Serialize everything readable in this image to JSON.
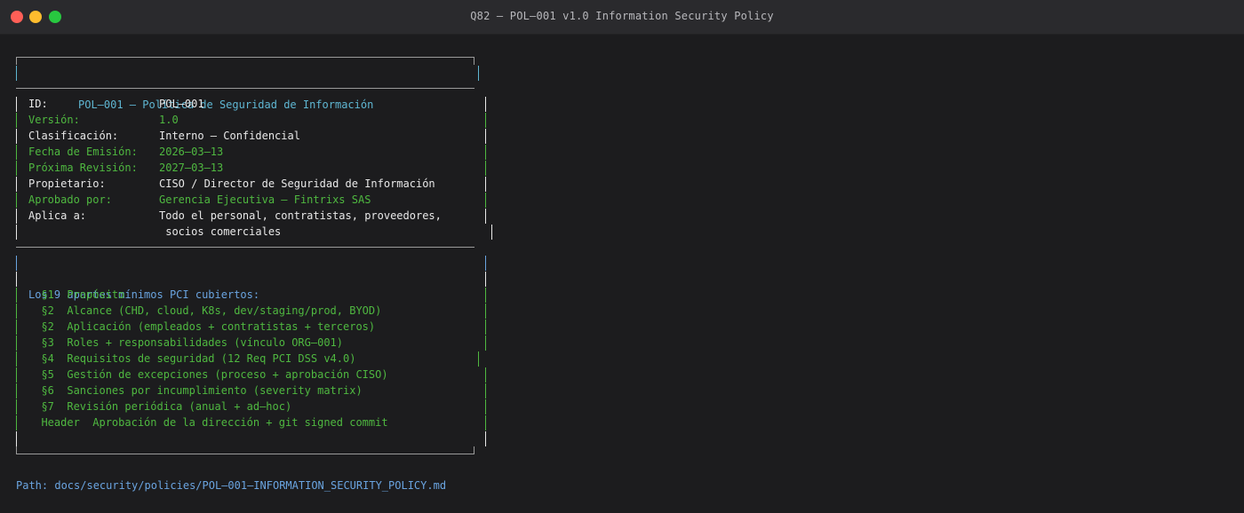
{
  "window": {
    "title": "Q82 — POL–001 v1.0 Information Security Policy"
  },
  "box": {
    "header": "POL–001 — Política de Seguridad de Información",
    "fields": [
      {
        "key": "ID:",
        "value": "POL–001",
        "color": "white"
      },
      {
        "key": "Versión:",
        "value": "1.0",
        "color": "green"
      },
      {
        "key": "Clasificación:",
        "value": "Interno — Confidencial",
        "color": "white"
      },
      {
        "key": "Fecha de Emisión:",
        "value": "2026–03–13",
        "color": "green"
      },
      {
        "key": "Próxima Revisión:",
        "value": "2027–03–13",
        "color": "green"
      },
      {
        "key": "Propietario:",
        "value": "CISO / Director de Seguridad de Información",
        "color": "white"
      },
      {
        "key": "Aprobado por:",
        "value": "Gerencia Ejecutiva — Fintrixs SAS",
        "color": "green"
      },
      {
        "key": "Aplica a:",
        "value": "Todo el personal, contratistas, proveedores,",
        "color": "white"
      },
      {
        "key": "",
        "value": " socios comerciales",
        "color": "white"
      }
    ],
    "sections_title": "Los 9 apartes mínimos PCI cubiertos:",
    "sections": [
      "  §1  Propósito",
      "  §2  Alcance (CHD, cloud, K8s, dev/staging/prod, BYOD)",
      "  §2  Aplicación (empleados + contratistas + terceros)",
      "  §3  Roles + responsabilidades (vínculo ORG–001)",
      "  §4  Requisitos de seguridad (12 Req PCI DSS v4.0)",
      "  §5  Gestión de excepciones (proceso + aprobación CISO)",
      "  §6  Sanciones por incumplimiento (severity matrix)",
      "  §7  Revisión periódica (anual + ad–hoc)",
      "  Header  Aprobación de la dirección + git signed commit"
    ]
  },
  "path": "Path: docs/security/policies/POL–001–INFORMATION_SECURITY_POLICY.md",
  "colors": {
    "white": "#e8e8e8",
    "green": "#4fb840",
    "cyan": "#5fb6d2",
    "blue": "#6aa4e0",
    "border": "#9a9a9a"
  }
}
